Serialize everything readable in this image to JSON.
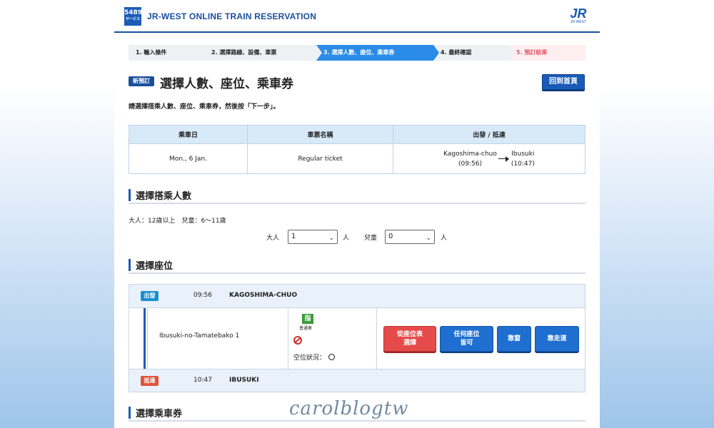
{
  "header": {
    "logo_text": "5489",
    "logo_sub": "サービス",
    "site_title": "JR-WEST ONLINE TRAIN RESERVATION",
    "brand_logo": "JR",
    "brand_sub": "JR-WEST"
  },
  "steps": [
    {
      "label": "1.  輸入條件"
    },
    {
      "label": "2.  選擇路線、設備、車票"
    },
    {
      "label": "3.  選擇人數、座位、乘車券"
    },
    {
      "label": "4.  最終確認"
    },
    {
      "label": "5.  預訂結果"
    }
  ],
  "title": {
    "badge": "新預訂",
    "text": "選擇人數、座位、乘車券",
    "home_button": "回到首頁"
  },
  "instruction": "請選擇搭乘人數、座位、乘車券，然後按「下一步」。",
  "info_table": {
    "headers": [
      "乘車日",
      "車票名稱",
      "出發 / 抵達"
    ],
    "date": "Mon., 6 Jan.",
    "ticket": "Regular ticket",
    "from_station": "Kagoshima-chuo",
    "from_time": "(09:56)",
    "to_station": "Ibusuki",
    "to_time": "(10:47)"
  },
  "passengers": {
    "heading": "選擇搭乘人數",
    "age_note": "大人：12歲以上　兒童：6〜11歲",
    "adult_label": "大人",
    "adult_value": "1",
    "child_label": "兒童",
    "child_value": "0",
    "unit": "人"
  },
  "seats": {
    "heading": "選擇座位",
    "dep_tag": "出發",
    "dep_time": "09:56",
    "dep_station": "KAGOSHIMA-CHUO",
    "train_name": "Ibusuki-no-Tamatebako 1",
    "car_type_icon": "指",
    "car_type_label": "普通車",
    "availability_label": "空位狀況：",
    "btn_seat_map": "從座位表\n選擇",
    "btn_any": "任何座位\n皆可",
    "btn_window": "靠窗",
    "btn_aisle": "靠走道",
    "arr_tag": "抵達",
    "arr_time": "10:47",
    "arr_station": "IBUSUKI"
  },
  "tickets": {
    "heading": "選擇乘車券"
  },
  "watermark": "carolblogtw"
}
